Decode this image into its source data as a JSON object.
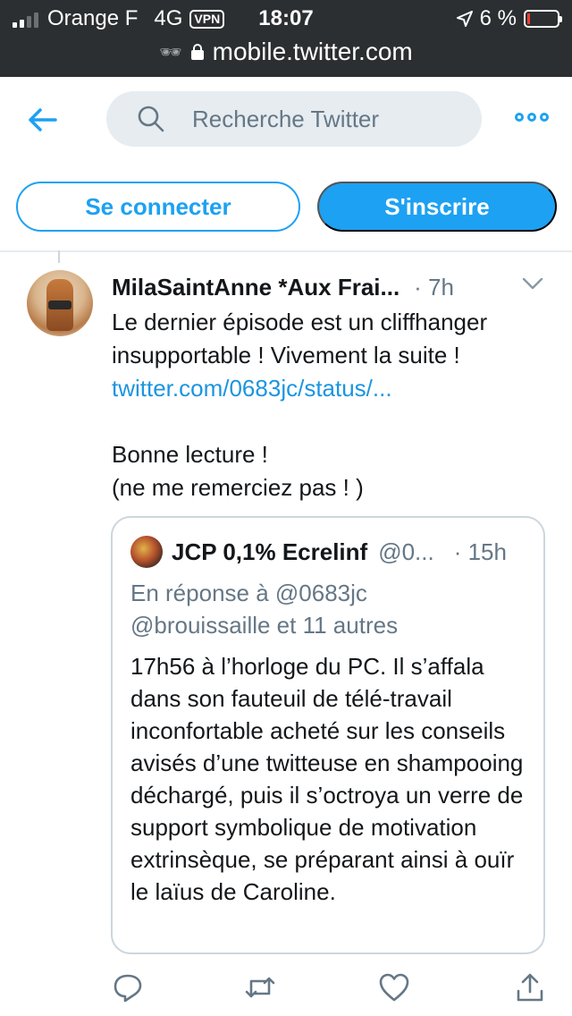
{
  "status_bar": {
    "carrier": "Orange F",
    "network": "4G",
    "vpn_label": "VPN",
    "time": "18:07",
    "battery_percent": "6 %",
    "battery_level": 0.06,
    "battery_color": "#ff3b30"
  },
  "browser": {
    "url": "mobile.twitter.com"
  },
  "header": {
    "search_placeholder": "Recherche Twitter",
    "login_label": "Se connecter",
    "signup_label": "S'inscrire"
  },
  "colors": {
    "accent": "#1da1f2",
    "link": "#1b95e0",
    "muted": "#657786"
  },
  "tweet": {
    "author": "MilaSaintAnne *Aux Frai...",
    "time": "· 7h",
    "text_line1": "Le dernier épisode est un cliffhanger insupportable ! Vivement la suite !",
    "link": "twitter.com/0683jc/status/...",
    "text_line2": "Bonne lecture !",
    "text_line3": "(ne me remerciez pas ! )",
    "quoted": {
      "author": "JCP 0,1% Ecrelinf",
      "handle": "@0...",
      "time": "· 15h",
      "reply_to_line1": "En réponse à @0683jc",
      "reply_to_line2": "@brouissaille  et 11 autres",
      "text": "17h56 à l’horloge du PC. Il s’affala dans son fauteuil de télé-travail inconfortable acheté sur les conseils avisés d’une twitteuse en shampooing déchargé, puis il s’octroya un verre de support symbolique de motivation extrinsèque, se préparant ainsi à ouïr le laïus de Caroline."
    }
  },
  "actions": {
    "icons": [
      "reply-icon",
      "retweet-icon",
      "like-icon",
      "share-icon"
    ]
  }
}
